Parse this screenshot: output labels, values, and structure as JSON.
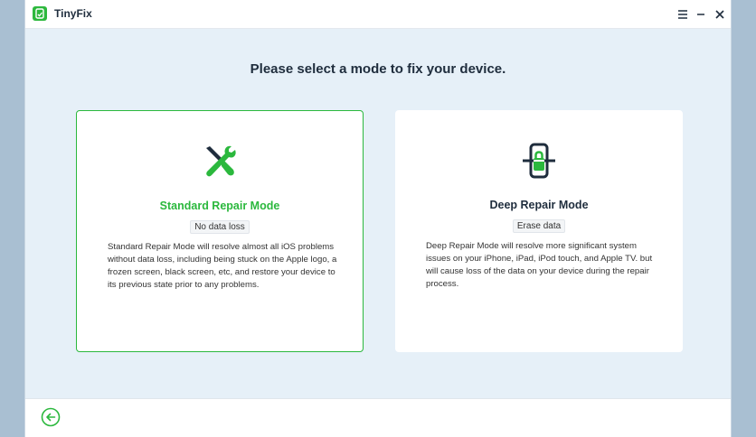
{
  "app": {
    "title": "TinyFix"
  },
  "heading": "Please select a mode to fix your device.",
  "colors": {
    "accent": "#2bb83d",
    "dark": "#1f2d3d"
  },
  "modes": [
    {
      "title": "Standard Repair Mode",
      "badge": "No data loss",
      "description": "Standard Repair Mode will resolve almost all iOS problems without data loss, including being stuck on the Apple logo, a frozen screen, black screen, etc, and restore your device to its previous state prior to any problems.",
      "icon": "tools-icon",
      "selected": true
    },
    {
      "title": "Deep Repair Mode",
      "badge": "Erase data",
      "description": "Deep Repair Mode will resolve more significant system issues on your iPhone, iPad, iPod touch, and Apple TV. but will cause loss of the data on your device during the repair process.",
      "icon": "phone-scan-icon",
      "selected": false
    }
  ]
}
